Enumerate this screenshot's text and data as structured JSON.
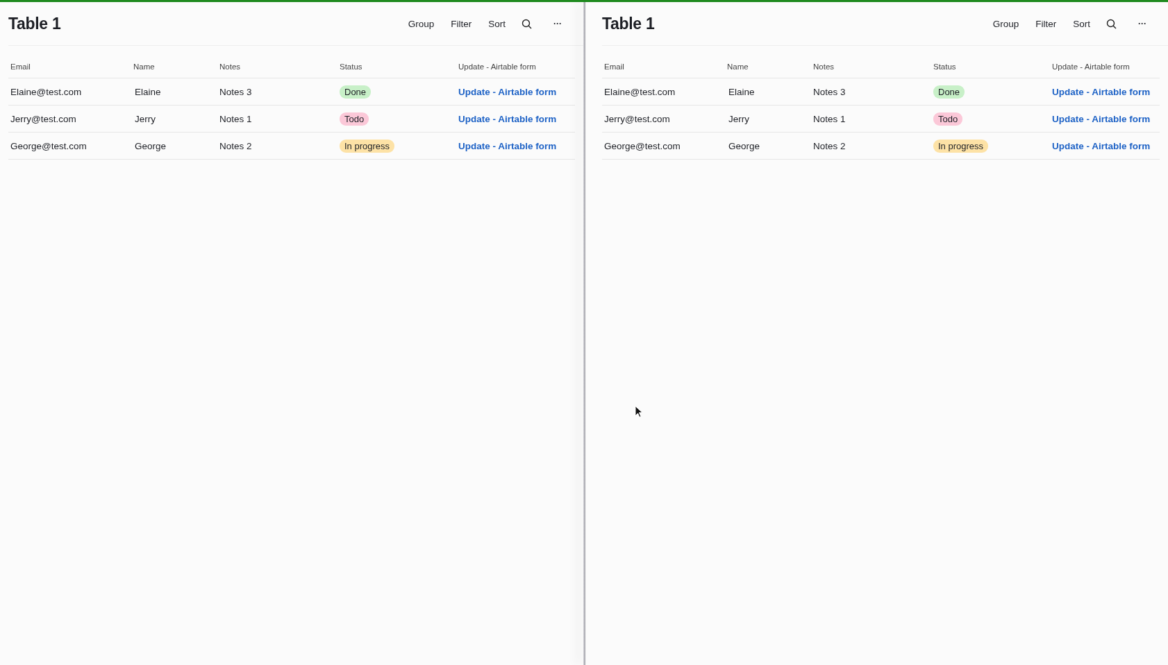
{
  "panels": [
    {
      "title": "Table 1",
      "toolbar": [
        {
          "kind": "text",
          "label": "Group"
        },
        {
          "kind": "text",
          "label": "Filter"
        },
        {
          "kind": "text",
          "label": "Sort"
        },
        {
          "kind": "search"
        },
        {
          "kind": "more",
          "label": "···"
        }
      ],
      "columns": [
        "Email",
        "Name",
        "Notes",
        "Status",
        "Update - Airtable form"
      ],
      "rows": [
        {
          "email": "Elaine@test.com",
          "name": "Elaine",
          "notes": "Notes 3",
          "status": {
            "label": "Done",
            "color": "#c8f0c8"
          },
          "link": "Update - Airtable form"
        },
        {
          "email": "Jerry@test.com",
          "name": "Jerry",
          "notes": "Notes 1",
          "status": {
            "label": "Todo",
            "color": "#fbc8d8"
          },
          "link": "Update - Airtable form"
        },
        {
          "email": "George@test.com",
          "name": "George",
          "notes": "Notes 2",
          "status": {
            "label": "In progress",
            "color": "#fde2a6"
          },
          "link": "Update - Airtable form"
        }
      ]
    },
    {
      "title": "Table 1",
      "toolbar": [
        {
          "kind": "text",
          "label": "Group"
        },
        {
          "kind": "text",
          "label": "Filter"
        },
        {
          "kind": "text",
          "label": "Sort"
        },
        {
          "kind": "search"
        },
        {
          "kind": "more",
          "label": "···"
        }
      ],
      "columns": [
        "Email",
        "Name",
        "Notes",
        "Status",
        "Update - Airtable form"
      ],
      "rows": [
        {
          "email": "Elaine@test.com",
          "name": "Elaine",
          "notes": "Notes 3",
          "status": {
            "label": "Done",
            "color": "#c8f0c8"
          },
          "link": "Update - Airtable form"
        },
        {
          "email": "Jerry@test.com",
          "name": "Jerry",
          "notes": "Notes 1",
          "status": {
            "label": "Todo",
            "color": "#fbc8d8"
          },
          "link": "Update - Airtable form"
        },
        {
          "email": "George@test.com",
          "name": "George",
          "notes": "Notes 2",
          "status": {
            "label": "In progress",
            "color": "#fde2a6"
          },
          "link": "Update - Airtable form"
        }
      ]
    }
  ]
}
